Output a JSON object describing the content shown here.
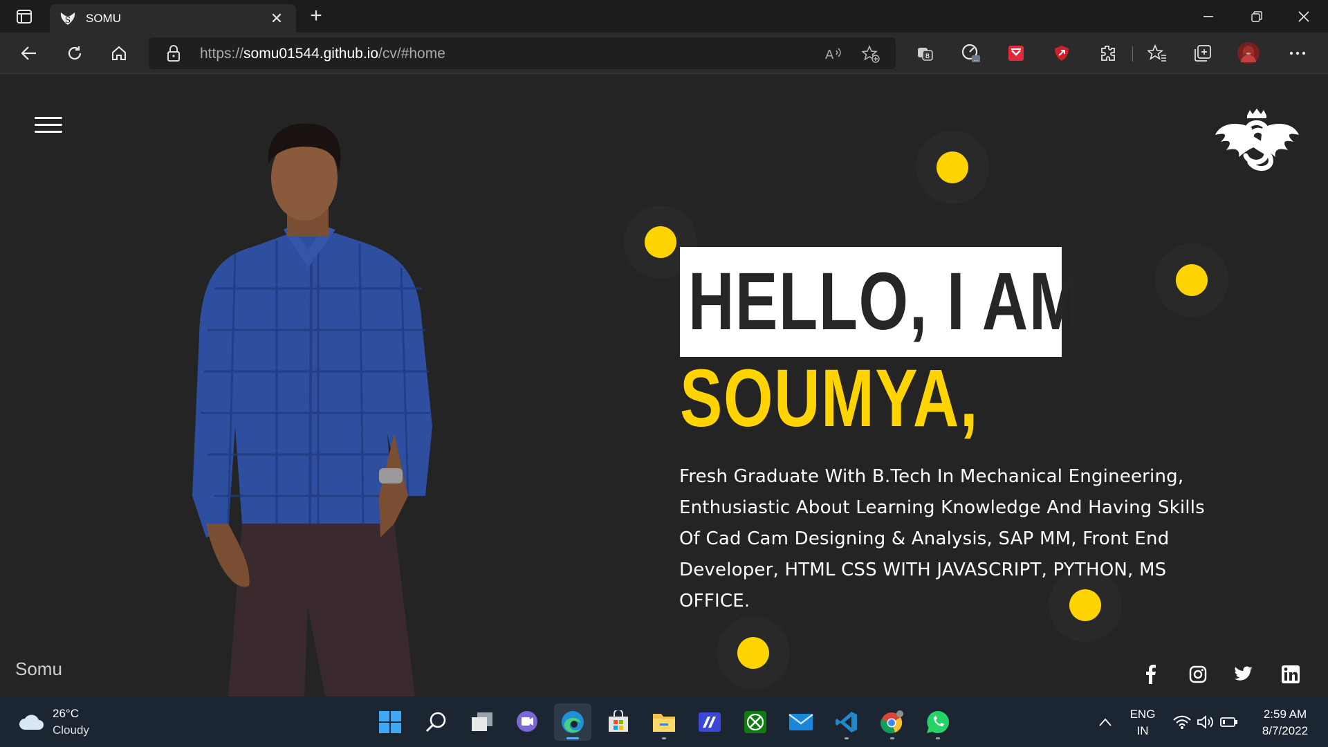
{
  "browser": {
    "tab_title": "SOMU",
    "url_prefix": "https://",
    "url_host": "somu01544.github.io",
    "url_path": "/cv/#home"
  },
  "page": {
    "hello_text": "HELLO, I AM",
    "name_text": "SOUMYA,",
    "bio_lines": [
      "Fresh Graduate With B.Tech In Mechanical Engineering,",
      "Enthusiastic About Learning Knowledge And Having Skills",
      "Of Cad Cam Designing & Analysis, SAP MM, Front End",
      "Developer, HTML CSS WITH JAVASCRIPT, PYTHON, MS",
      "OFFICE."
    ],
    "footer_name": "Somu",
    "social_icons": [
      "facebook-icon",
      "instagram-icon",
      "twitter-icon",
      "linkedin-icon"
    ],
    "accent_color": "#ffd400",
    "background_color": "#242424"
  },
  "taskbar": {
    "weather_temp": "26°C",
    "weather_desc": "Cloudy",
    "lang_line1": "ENG",
    "lang_line2": "IN",
    "time": "2:59 AM",
    "date": "8/7/2022"
  }
}
